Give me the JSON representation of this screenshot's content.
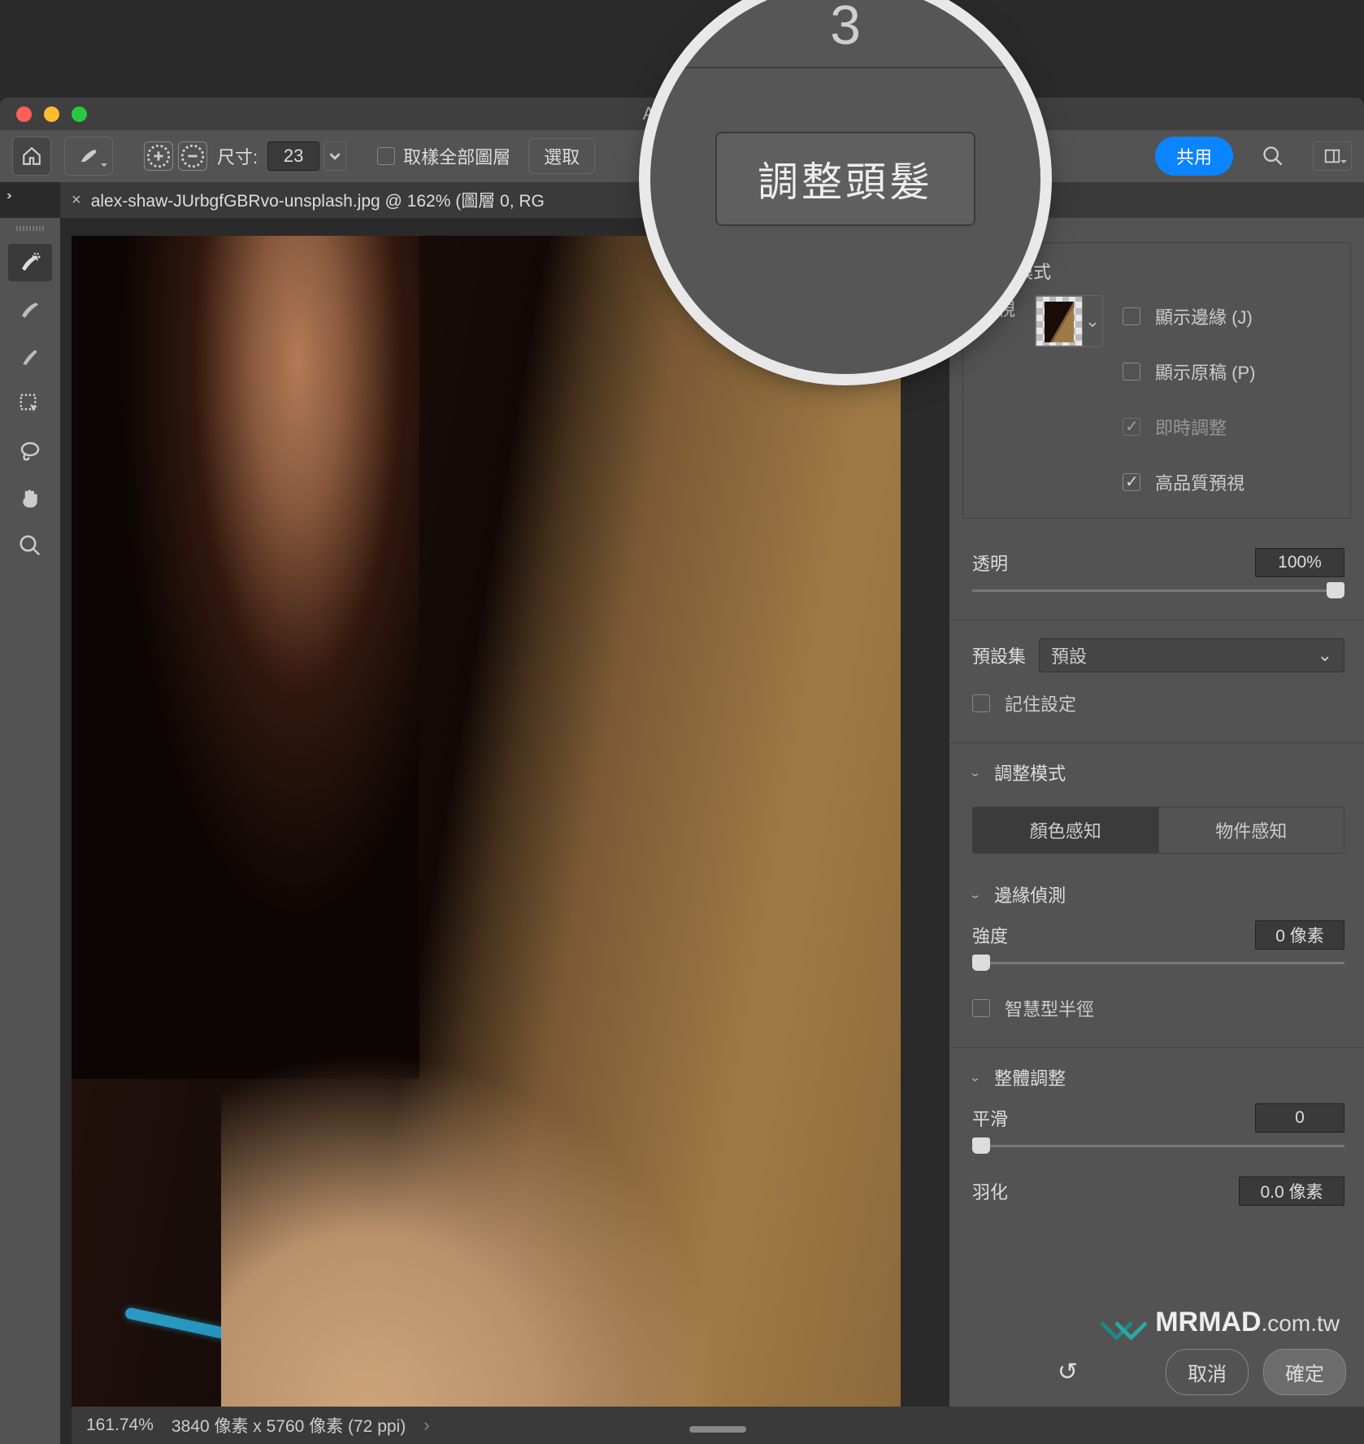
{
  "app": {
    "title": "Adobe Ph"
  },
  "traffic": {
    "close": "close",
    "min": "minimize",
    "max": "zoom"
  },
  "toolbar": {
    "size_label": "尺寸:",
    "size_value": "23",
    "sample_all_label": "取樣全部圖層",
    "select_btn": "選取",
    "share_label": "共用"
  },
  "tab": {
    "title": "alex-shaw-JUrbgfGBRvo-unsplash.jpg @ 162% (圖層 0, RG"
  },
  "status": {
    "zoom": "161.74%",
    "doc": "3840 像素 x 5760 像素 (72 ppi)"
  },
  "magnifier": {
    "top_frag": "3",
    "button": "調整頭髮"
  },
  "panel": {
    "view_mode_title": "檢視模式",
    "view_label": "檢視",
    "show_edge": "顯示邊緣 (J)",
    "show_orig": "顯示原稿 (P)",
    "realtime": "即時調整",
    "hq_preview": "高品質預視",
    "opacity_label": "透明",
    "opacity_value": "100%",
    "preset_label": "預設集",
    "preset_value": "預設",
    "remember": "記住設定",
    "adjust_mode": "調整模式",
    "seg_a": "顏色感知",
    "seg_b": "物件感知",
    "edge_title": "邊緣偵測",
    "strength_label": "強度",
    "strength_value": "0 像素",
    "smart_radius": "智慧型半徑",
    "global_title": "整體調整",
    "smooth_label": "平滑",
    "smooth_value": "0",
    "feather_label": "羽化",
    "feather_value": "0.0 像素",
    "cancel": "取消",
    "ok": "確定"
  },
  "watermark": {
    "brand": "MRMAD",
    "suffix": ".com.tw"
  }
}
